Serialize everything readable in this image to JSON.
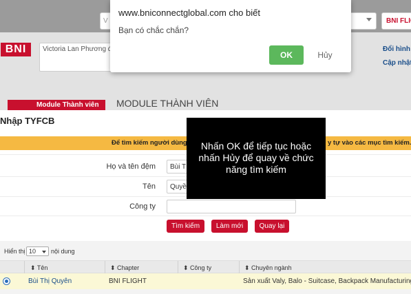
{
  "dialog": {
    "title": "www.bniconnectglobal.com cho biết",
    "message": "Bạn có chắc chắn?",
    "ok_label": "OK",
    "cancel_label": "Hủy",
    "ok_color": "#5cb85c"
  },
  "tooltip": {
    "text": "Nhấn OK để tiếp tục hoặc nhấn Hủy để quay về chức năng tìm kiếm"
  },
  "topbar": {
    "left_select": "V",
    "right_select": "BNI FLIGH"
  },
  "header": {
    "logo": "BNI",
    "profile_text": "Victoria Lan Phương đ",
    "links": [
      "Đổi hình",
      "Cập nhật"
    ]
  },
  "module": {
    "tab_label": "Module Thành viên",
    "title": "MODULE THÀNH VIÊN"
  },
  "panel": {
    "title": "Nhập TYFCB",
    "hint_left": "Để tìm kiếm người dùng",
    "hint_right": "y tự vào các mục tìm kiếm."
  },
  "form": {
    "fields": [
      {
        "label": "Họ và tên đệm",
        "value": "Bùi T"
      },
      {
        "label": "Tên",
        "value": "Quyề"
      },
      {
        "label": "Công ty",
        "value": ""
      }
    ],
    "buttons": [
      "Tìm kiếm",
      "Làm mới",
      "Quay lại"
    ]
  },
  "table": {
    "show_prefix": "Hiển thị",
    "page_size": "10",
    "show_suffix": "nội dung",
    "columns": [
      "Tên",
      "Chapter",
      "Công ty",
      "Chuyên ngành"
    ],
    "rows": [
      {
        "name": "Bùi Thị Quyên",
        "chapter": "BNI FLIGHT",
        "company": "",
        "specialty": "Sản xuất Valy, Balo - Suitcase, Backpack Manufacturing"
      }
    ]
  },
  "colors": {
    "brand_red": "#c8102e",
    "hint_bg": "#f5b942",
    "selected_row": "#fbf8d6"
  }
}
